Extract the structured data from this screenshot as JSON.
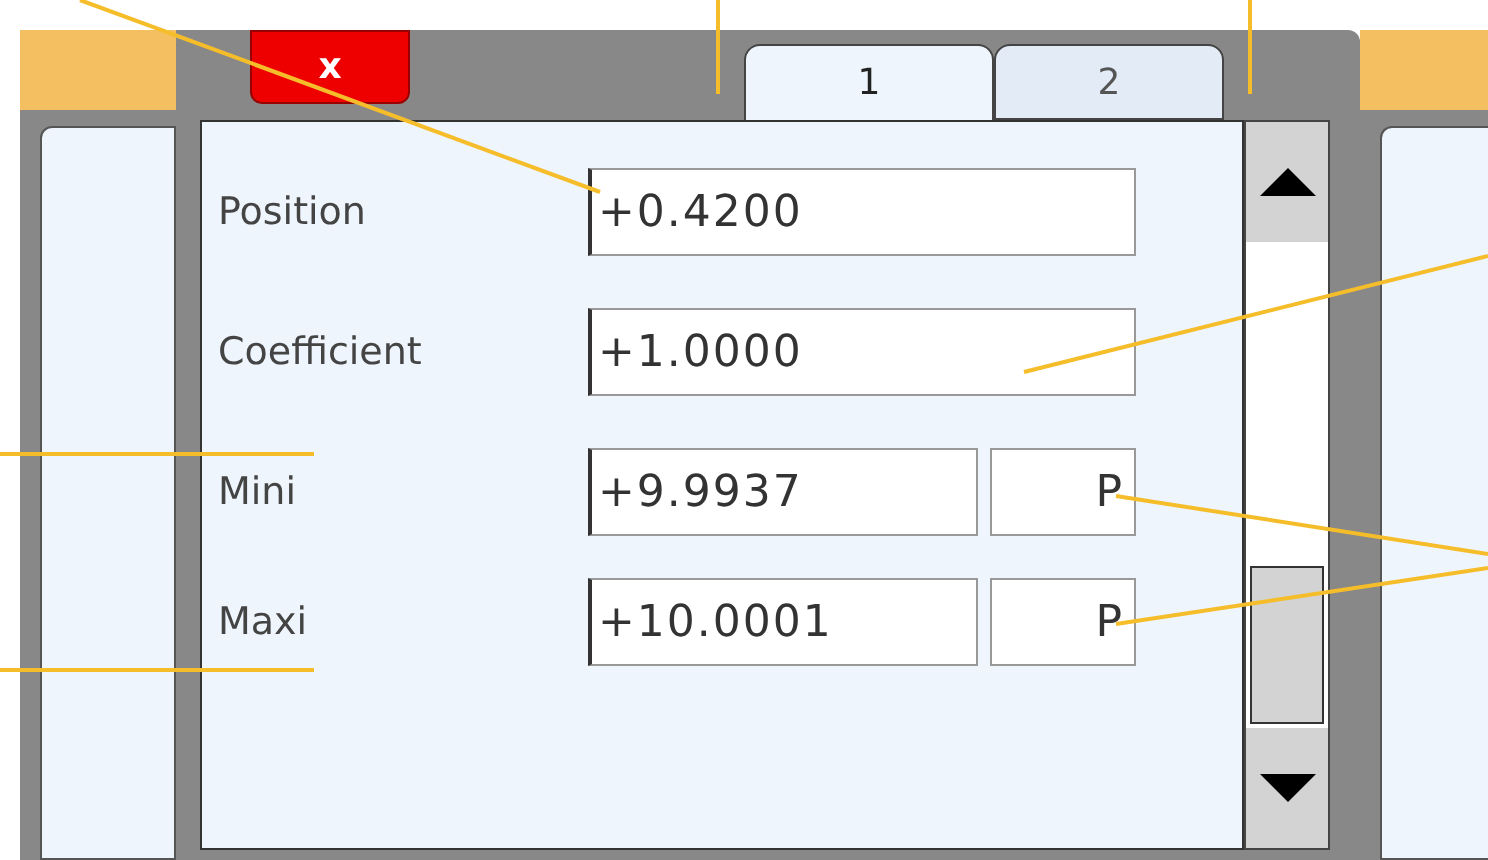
{
  "close_button": {
    "label": "x"
  },
  "tabs": [
    {
      "label": "1",
      "selected": true
    },
    {
      "label": "2",
      "selected": false
    }
  ],
  "rows": [
    {
      "label": "Position",
      "value": "+0.4200"
    },
    {
      "label": "Coefficient",
      "value": "+1.0000"
    },
    {
      "label": "Mini",
      "value": "+9.9937",
      "unit": "P"
    },
    {
      "label": "Maxi",
      "value": "+10.0001",
      "unit": "P"
    }
  ]
}
